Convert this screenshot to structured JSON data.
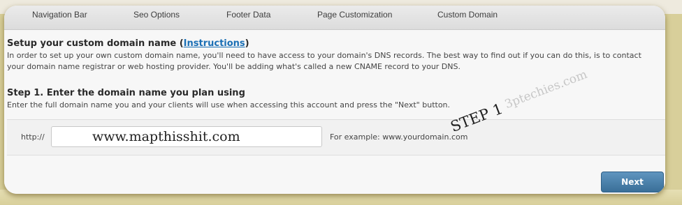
{
  "tabs": [
    {
      "label": "Navigation Bar"
    },
    {
      "label": "Seo Options"
    },
    {
      "label": "Footer Data"
    },
    {
      "label": "Page Customization"
    },
    {
      "label": "Custom Domain"
    }
  ],
  "setup": {
    "title": "Setup your custom domain name (",
    "link": "Instructions",
    "title_end": ")",
    "description": "In order to set up your own custom domain name, you'll need to have access to your domain's DNS records. The best way to find out if you can do this, is to contact your domain name registrar or web hosting provider. You'll be adding what's called a new CNAME record to your DNS."
  },
  "step1": {
    "title": "Step 1. Enter the domain name you plan using",
    "description": "Enter the full domain name you and your clients will use when accessing this account and press the \"Next\" button."
  },
  "domain": {
    "prefix": "http://",
    "value": "www.mapthisshit.com",
    "example": "For example: www.yourdomain.com"
  },
  "watermark": {
    "step_text": "STEP 1",
    "brand_text": "3ptechies.com"
  },
  "actions": {
    "next_label": "Next"
  }
}
